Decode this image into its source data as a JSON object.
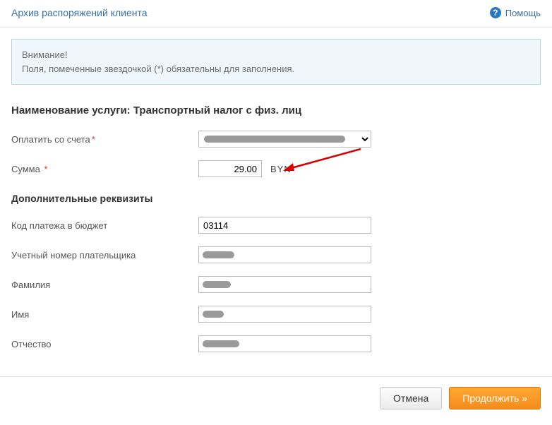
{
  "header": {
    "archive_link": "Архив распоряжений клиента",
    "help_label": "Помощь"
  },
  "alert": {
    "title": "Внимание!",
    "text": "Поля, помеченные звездочкой (*) обязательны для заполнения."
  },
  "service": {
    "prefix": "Наименование услуги:",
    "name": "Транспортный налог с физ. лиц"
  },
  "form": {
    "account_label": "Оплатить со счета",
    "amount_label": "Сумма",
    "amount_value": "29.00",
    "currency": "BYN",
    "additional_title": "Дополнительные реквизиты",
    "budget_code_label": "Код платежа в бюджет",
    "budget_code_value": "03114",
    "payer_num_label": "Учетный номер плательщика",
    "surname_label": "Фамилия",
    "name_label": "Имя",
    "patronymic_label": "Отчество"
  },
  "buttons": {
    "cancel": "Отмена",
    "continue": "Продолжить »"
  }
}
